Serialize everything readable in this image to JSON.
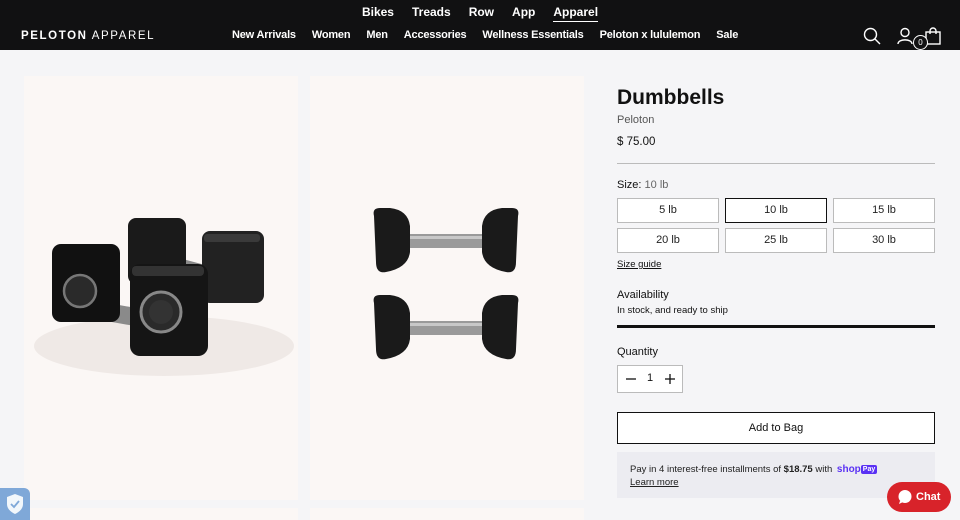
{
  "header": {
    "logo_bold": "PELOTON",
    "logo_light": "APPAREL",
    "top_nav": [
      "Bikes",
      "Treads",
      "Row",
      "App",
      "Apparel"
    ],
    "top_nav_active": "Apparel",
    "main_nav": [
      "New Arrivals",
      "Women",
      "Men",
      "Accessories",
      "Wellness Essentials",
      "Peloton x lululemon",
      "Sale"
    ],
    "cart_count": "0",
    "icons": [
      "search-icon",
      "account-icon",
      "bag-icon"
    ]
  },
  "gallery": {
    "images": [
      "dumbbells-angled-image",
      "dumbbells-top-view-image"
    ]
  },
  "product": {
    "title": "Dumbbells",
    "brand": "Peloton",
    "price": "$ 75.00",
    "size_label": "Size:",
    "size_selected": "10 lb",
    "sizes": [
      "5 lb",
      "10 lb",
      "15 lb",
      "20 lb",
      "25 lb",
      "30 lb"
    ],
    "size_guide": "Size guide",
    "availability_label": "Availability",
    "availability_text": "In stock, and ready to ship",
    "quantity_label": "Quantity",
    "quantity_value": "1",
    "add_to_bag": "Add to Bag",
    "shoppay": {
      "text_before": "Pay in 4 interest-free installments of ",
      "amount": "$18.75",
      "text_after": " with ",
      "shop_word": "shop",
      "pay_badge": "Pay",
      "learn_more": "Learn more"
    }
  },
  "chat": {
    "label": "Chat"
  },
  "colors": {
    "header_bg": "#111112",
    "image_bg": "#fbf7f5",
    "chat_red": "#d8232a",
    "shoppay_purple": "#5a31f4"
  }
}
